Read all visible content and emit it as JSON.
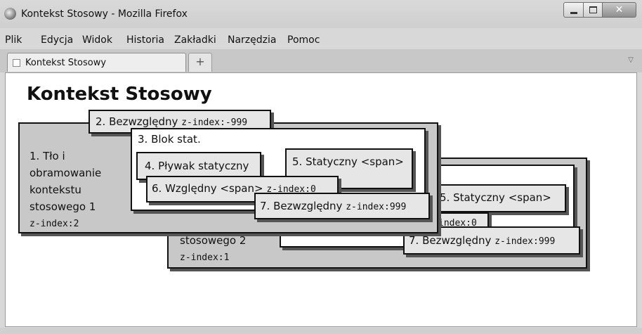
{
  "window": {
    "title": "Kontekst Stosowy - Mozilla Firefox",
    "icon": "firefox-icon"
  },
  "menu": [
    "Plik",
    "Edycja",
    "Widok",
    "Historia",
    "Zakładki",
    "Narzędzia",
    "Pomoc"
  ],
  "tab": {
    "title": "Kontekst Stosowy",
    "new_tab": "+"
  },
  "page": {
    "heading": "Kontekst Stosowy",
    "ctx1": {
      "lines": [
        "1. Tło i",
        "obramowanie",
        "kontekstu",
        "stosowego 1"
      ],
      "zindex": "z-index:2",
      "abs_neg_label": "2. Bezwzględny",
      "abs_neg_code": "z-index:-999",
      "block_label": "3. Blok stat.",
      "float_label": "4. Pływak statyczny",
      "relative_label": "6. Względny <span>",
      "relative_code": "z-index:0",
      "static_span_label": "5. Statyczny <span>",
      "abs_pos_label": "7. Bezwzględny",
      "abs_pos_code": "z-index:999"
    },
    "ctx2": {
      "line": "stosowego 2",
      "zindex": "z-index:1",
      "static_span_label": "5. Statyczny <span>",
      "relative_code_fragment": "index:0",
      "abs_pos_label": "7. Bezwzględny",
      "abs_pos_code": "z-index:999"
    }
  },
  "colors": {
    "context_bg": "#c8c8c8",
    "box_bg": "#e6e6e6",
    "block_bg": "#ffffff"
  }
}
